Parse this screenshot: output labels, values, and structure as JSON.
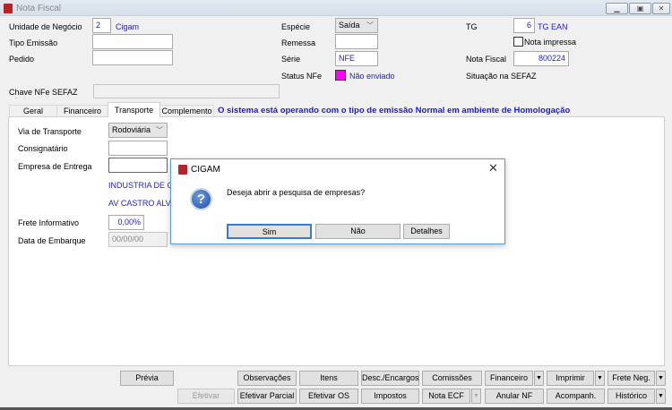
{
  "window": {
    "title": "Nota Fiscal",
    "controls": [
      "minimize",
      "restore",
      "close"
    ]
  },
  "header": {
    "unidade_label": "Unidade de Negócio",
    "unidade_value": "2",
    "unidade_name": "Cigam",
    "tipo_emissao_label": "Tipo Emissão",
    "tipo_emissao_value": "",
    "pedido_label": "Pedido",
    "pedido_value": "",
    "especie_label": "Espécie",
    "especie_value": "Saída",
    "remessa_label": "Remessa",
    "remessa_value": "",
    "serie_label": "Série",
    "serie_value": "NFE",
    "status_label": "Status NFe",
    "status_value": "Não enviado",
    "status_color": "#ff00ff",
    "tg_label": "TG",
    "tg_value": "6",
    "tg_name": "TG EAN",
    "nota_impressa_label": "Nota impressa",
    "nota_impressa_checked": false,
    "nota_fiscal_label": "Nota Fiscal",
    "nota_fiscal_value": "800224",
    "situacao_label": "Situação na SEFAZ",
    "chave_label": "Chave NFe SEFAZ",
    "chave_value": ""
  },
  "tabs": [
    {
      "label": "Geral"
    },
    {
      "label": "Financeiro"
    },
    {
      "label": "Transporte",
      "active": true
    },
    {
      "label": "Complemento"
    }
  ],
  "environment_message": "O sistema está operando com o tipo de emissão Normal em ambiente de Homologação",
  "transporte": {
    "via_label": "Via de Transporte",
    "via_value": "Rodoviária",
    "consignatario_label": "Consignatário",
    "consignatario_value": "",
    "empresa_label": "Empresa de Entrega",
    "empresa_value": "",
    "empresa_nome": "INDUSTRIA DE CAL",
    "empresa_endereco": "AV CASTRO ALVES,",
    "frete_label": "Frete Informativo",
    "frete_value": "0,00%",
    "data_label": "Data de Embarque",
    "data_value": "00/00/00"
  },
  "dialog": {
    "title": "CIGAM",
    "message": "Deseja abrir a pesquisa de empresas?",
    "icon": "question-icon",
    "buttons": [
      "Sim",
      "Não",
      "Detalhes"
    ]
  },
  "toolbar": {
    "row1": [
      "Prévia",
      "Observações",
      "Itens",
      "Desc./Encargos",
      "Comissões",
      "Financeiro",
      "Imprimir",
      "Frete Neg."
    ],
    "row2": [
      "Efetivar",
      "Efetivar Parcial",
      "Efetivar OS",
      "Impostos",
      "Nota ECF",
      "Anular NF",
      "Acompanh.",
      "Histórico"
    ]
  }
}
